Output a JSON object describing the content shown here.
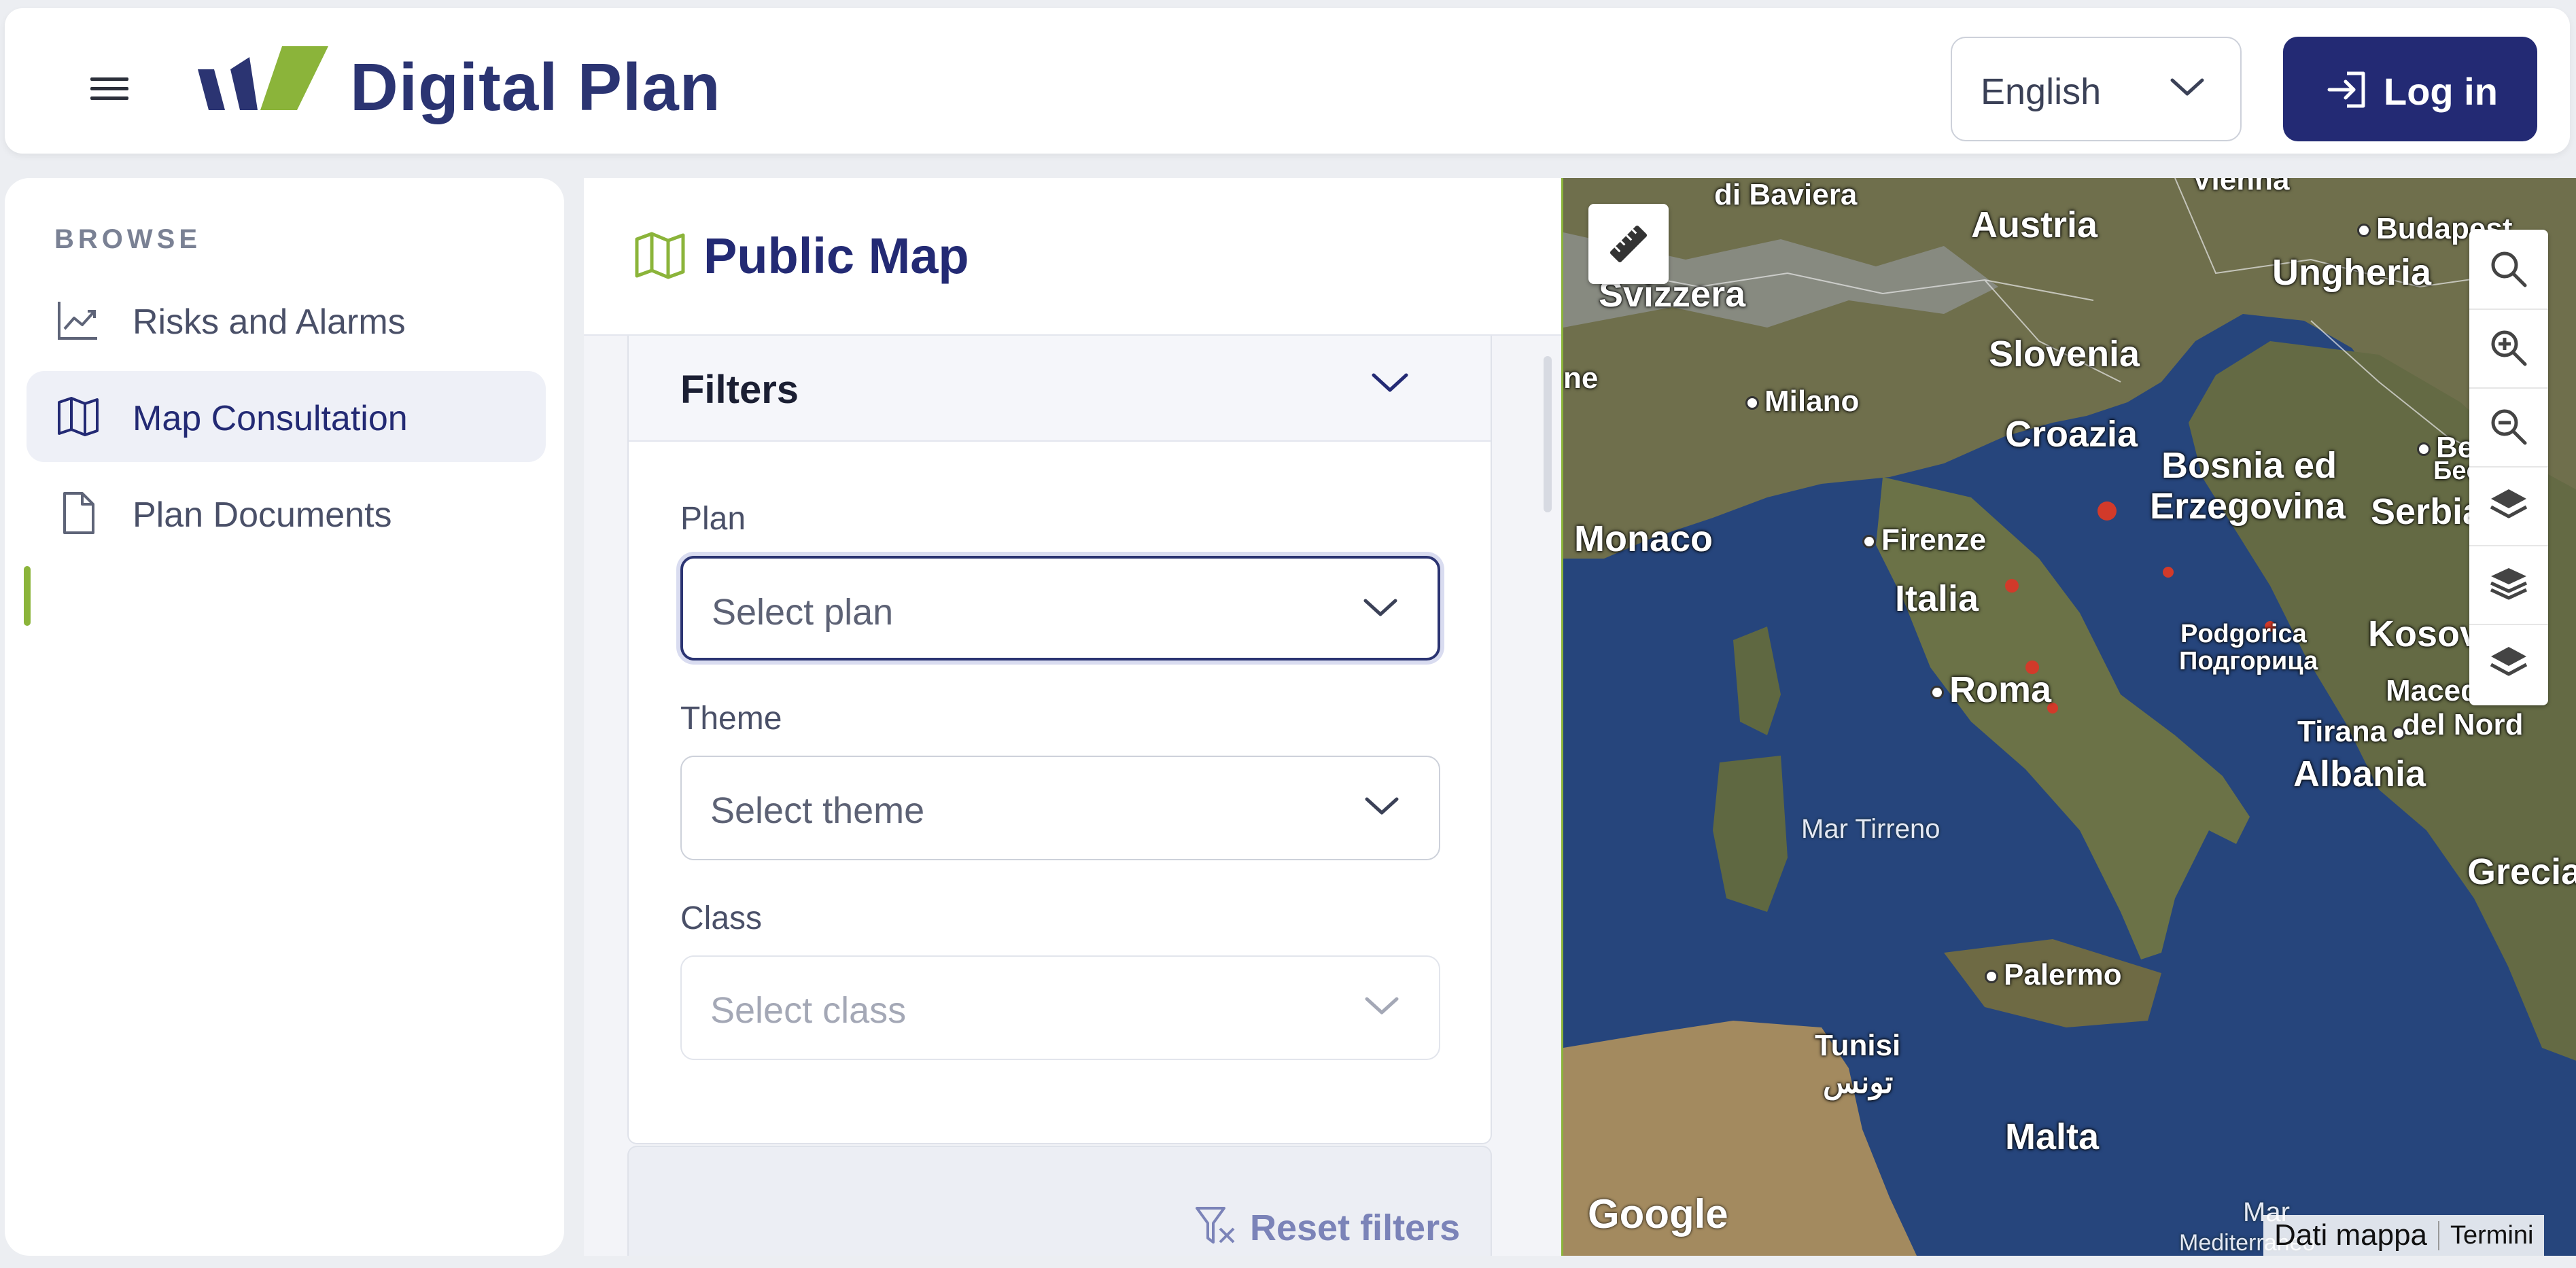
{
  "header": {
    "brand": "Digital Plan",
    "language": {
      "selected": "English"
    },
    "login_label": "Log in"
  },
  "sidebar": {
    "section_label": "BROWSE",
    "items": [
      {
        "label": "Risks and Alarms",
        "icon": "chart-line-icon",
        "active": false
      },
      {
        "label": "Map Consultation",
        "icon": "map-icon",
        "active": true
      },
      {
        "label": "Plan Documents",
        "icon": "document-icon",
        "active": false
      }
    ]
  },
  "main": {
    "title": "Public Map",
    "filters": {
      "title": "Filters",
      "plan": {
        "label": "Plan",
        "placeholder": "Select plan"
      },
      "theme": {
        "label": "Theme",
        "placeholder": "Select theme"
      },
      "class": {
        "label": "Class",
        "placeholder": "Select class"
      },
      "reset_label": "Reset filters"
    }
  },
  "map": {
    "labels": {
      "vienna": "Vienna",
      "baviera": "di Baviera",
      "austria": "Austria",
      "budapest": "Budapest",
      "ungheria": "Ungheria",
      "svizzera": "Svizzera",
      "slovenia": "Slovenia",
      "ne": "ne",
      "milano": "Milano",
      "croazia": "Croazia",
      "bosnia1": "Bosnia ed",
      "bosnia2": "Erzegovina",
      "belg1": "Belg",
      "belg2": "Беог",
      "serbia": "Serbia",
      "monaco": "Monaco",
      "firenze": "Firenze",
      "italia": "Italia",
      "podgorica1": "Podgorica",
      "podgorica2": "Подгорица",
      "kosovo": "Kosovo",
      "roma": "Roma",
      "macedonia1": "Macedonia",
      "macedonia2": "del Nord",
      "tirana": "Tirana",
      "albania": "Albania",
      "mar_tirreno": "Mar Tirreno",
      "grecia": "Grecia",
      "palermo": "Palermo",
      "tunisi1": "Tunisi",
      "tunisi2": "تونس",
      "malta": "Malta",
      "mar": "Mar",
      "mediterraneo": "Mediterraneo"
    },
    "google": "Google",
    "attribution": {
      "data": "Dati mappa",
      "terms": "Termini"
    }
  },
  "colors": {
    "brand_navy": "#232a74",
    "accent_green": "#8bb43a",
    "map_sea": "#26457c",
    "risk_red": "#d23a2a"
  }
}
